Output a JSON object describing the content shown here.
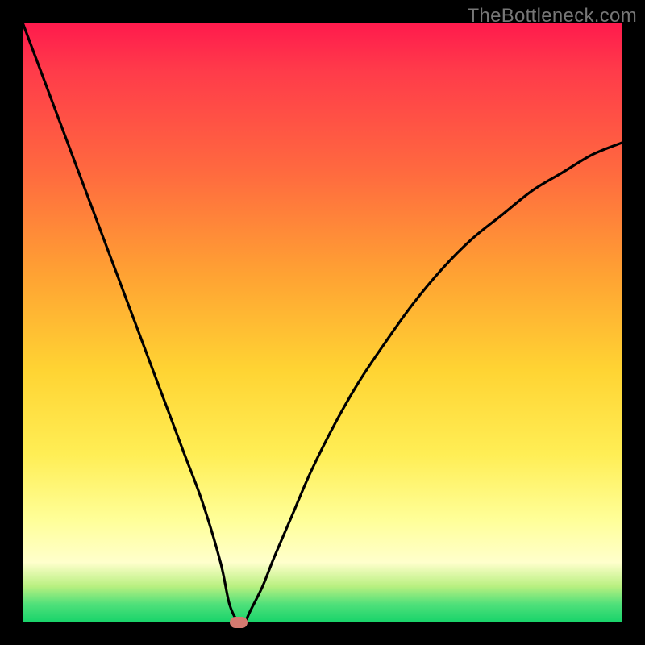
{
  "watermark": "TheBottleneck.com",
  "colors": {
    "frame": "#000000",
    "curve": "#000000",
    "marker": "#d47a70",
    "gradient_stops": [
      "#ff1a4d",
      "#ff6a3f",
      "#ffa233",
      "#ffd433",
      "#ffee55",
      "#ffff99",
      "#ffffcc",
      "#b8f080",
      "#4fe07a",
      "#17d36a"
    ]
  },
  "chart_data": {
    "type": "line",
    "title": "",
    "xlabel": "",
    "ylabel": "",
    "xlim": [
      0,
      100
    ],
    "ylim": [
      0,
      100
    ],
    "grid": false,
    "legend": false,
    "series": [
      {
        "name": "bottleneck-curve",
        "x": [
          0,
          3,
          6,
          9,
          12,
          15,
          18,
          21,
          24,
          27,
          30,
          33,
          34.5,
          36,
          37,
          38,
          40,
          42,
          45,
          48,
          52,
          56,
          60,
          65,
          70,
          75,
          80,
          85,
          90,
          95,
          100
        ],
        "y": [
          100,
          92,
          84,
          76,
          68,
          60,
          52,
          44,
          36,
          28,
          20,
          10,
          3,
          0,
          0,
          2,
          6,
          11,
          18,
          25,
          33,
          40,
          46,
          53,
          59,
          64,
          68,
          72,
          75,
          78,
          80
        ]
      }
    ],
    "marker": {
      "x": 36,
      "y": 0
    },
    "annotations": []
  }
}
